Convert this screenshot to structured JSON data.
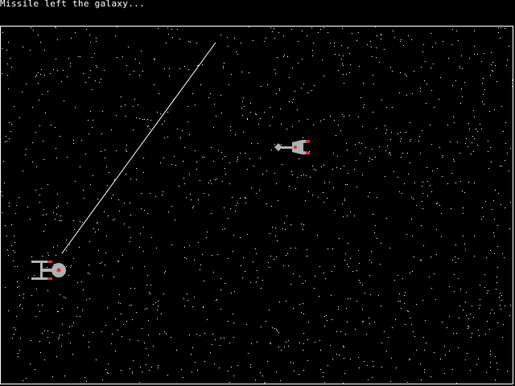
{
  "game": {
    "status_message": "Missile left the galaxy...",
    "colors": {
      "background": "#000000",
      "border": "#ffffff",
      "stars": "#ffffff",
      "ship_hull": "#b0b0b0",
      "ship_lights": "#e03030",
      "missile_trail": "#ffffff"
    },
    "player_ship": {
      "icon": "federation-starship-icon"
    },
    "enemy_ship": {
      "icon": "klingon-cruiser-icon"
    },
    "missile_trail": {
      "icon": "missile-trail-line"
    }
  }
}
